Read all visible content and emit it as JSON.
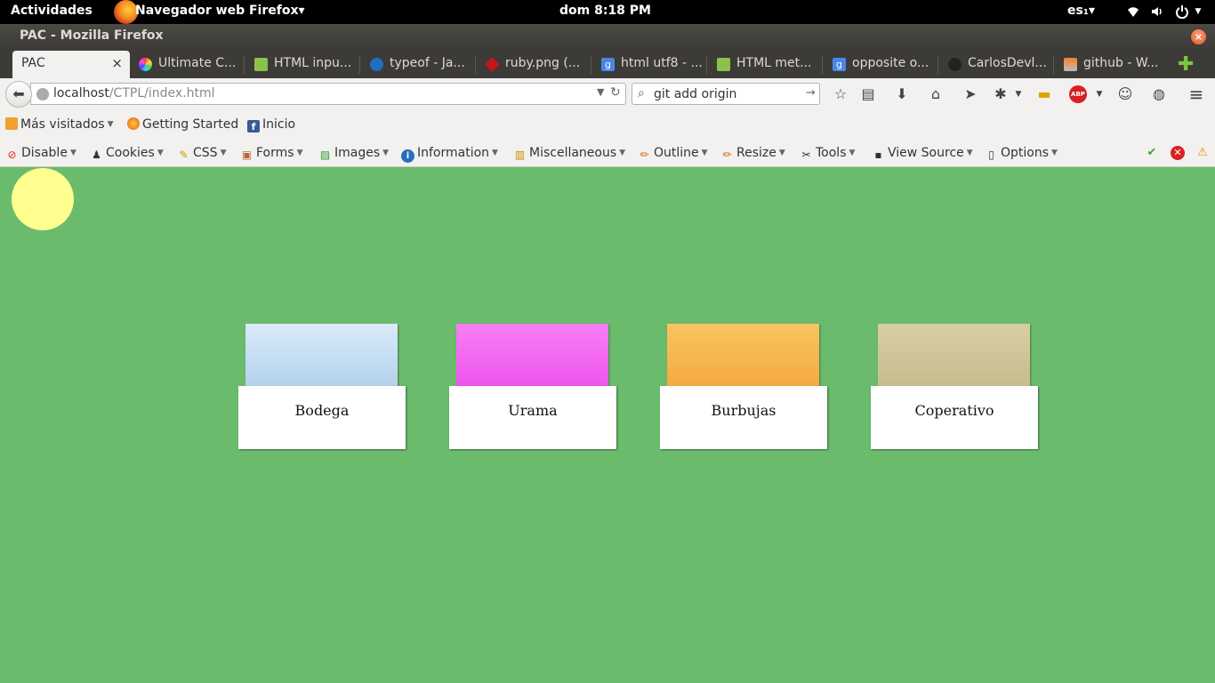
{
  "topbar": {
    "activities": "Actividades",
    "app_menu": "Navegador web Firefox▾",
    "clock": "dom  8:18 PM",
    "keyboard": "es₁▾",
    "tray_icons": [
      "wifi-icon",
      "volume-icon",
      "power-icon"
    ]
  },
  "window": {
    "title": "PAC - Mozilla Firefox",
    "close_glyph": "×"
  },
  "tabs": [
    {
      "label": "PAC",
      "active": true,
      "close": "×"
    },
    {
      "label": "Ultimate C...",
      "favicon_color": "#c94bd6"
    },
    {
      "label": "HTML inpu...",
      "favicon_color": "#8bc34a"
    },
    {
      "label": "typeof - Ja...",
      "favicon_color": "#1e6fc4"
    },
    {
      "label": "ruby.png (...",
      "favicon_color": "#c0161c"
    },
    {
      "label": "html utf8 - ...",
      "favicon_color": "#4a86e8"
    },
    {
      "label": "HTML met...",
      "favicon_color": "#8bc34a"
    },
    {
      "label": "opposite o...",
      "favicon_color": "#4a86e8"
    },
    {
      "label": "CarlosDevl...",
      "favicon_color": "#222222"
    },
    {
      "label": "github - W...",
      "favicon_color": "#f48024"
    }
  ],
  "new_tab": "✚",
  "nav": {
    "back": "⬅",
    "url_host": "localhost",
    "url_path": "/CTPL/index.html",
    "url_dropdown": "▼",
    "reload": "↻",
    "search_value": "git add origin",
    "search_go": "→",
    "icons": [
      "star-icon",
      "reading-list-icon",
      "download-icon",
      "home-icon",
      "send-icon",
      "wrench-icon",
      "ruler-icon",
      "adblock-icon",
      "chat-icon",
      "globe-icon",
      "menu-icon"
    ]
  },
  "bookmarks": [
    {
      "label": "Más visitados",
      "has_caret": true
    },
    {
      "label": "Getting Started"
    },
    {
      "label": "Inicio"
    }
  ],
  "devtoolbar": [
    {
      "label": "Disable",
      "icon": "disable-icon"
    },
    {
      "label": "Cookies",
      "icon": "cookies-icon"
    },
    {
      "label": "CSS",
      "icon": "css-icon"
    },
    {
      "label": "Forms",
      "icon": "forms-icon"
    },
    {
      "label": "Images",
      "icon": "images-icon"
    },
    {
      "label": "Information",
      "icon": "information-icon"
    },
    {
      "label": "Miscellaneous",
      "icon": "miscellaneous-icon"
    },
    {
      "label": "Outline",
      "icon": "outline-icon"
    },
    {
      "label": "Resize",
      "icon": "resize-icon"
    },
    {
      "label": "Tools",
      "icon": "tools-icon"
    },
    {
      "label": "View Source",
      "icon": "view-source-icon"
    },
    {
      "label": "Options",
      "icon": "options-icon"
    }
  ],
  "status_icons": [
    "check-icon",
    "error-icon",
    "warning-icon"
  ],
  "page": {
    "background": "#6bbb6d",
    "sun_color": "#ffff90",
    "cards": [
      {
        "label": "Bodega",
        "color_top": "#d9eafb",
        "color_bottom": "#b4d2ec"
      },
      {
        "label": "Urama",
        "color_top": "#f77ff4",
        "color_bottom": "#ee55ec"
      },
      {
        "label": "Burbujas",
        "color_top": "#f8c561",
        "color_bottom": "#f5a940"
      },
      {
        "label": "Coperativo",
        "color_top": "#d7cfa3",
        "color_bottom": "#c5bd8d"
      }
    ]
  }
}
